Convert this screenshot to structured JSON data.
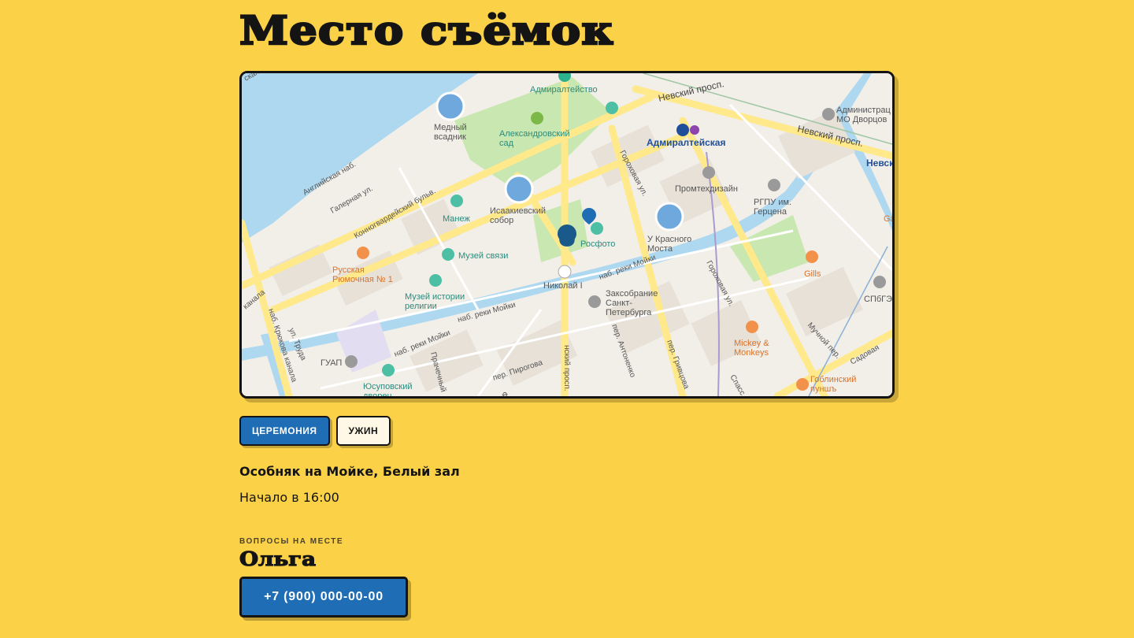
{
  "page": {
    "title": "Место съёмок"
  },
  "map": {
    "labels": {
      "admiralteystvo": "Адмиралтейство",
      "medny": "Медный\nвсадник",
      "alexsad": "Александровский\nсад",
      "nevsky1": "Невский просп.",
      "nevsky2": "Невский просп.",
      "nevsky_cut": "Невск",
      "admin": "Администрац\nМО Дворцов",
      "metro": "Адмиралтейская",
      "metro_line": "5",
      "gorokhovaya1": "Гороховая ул.",
      "promtech": "Промтехдизайн",
      "rgpu": "РГПУ им.\nГерцена",
      "angl": "Английская наб.",
      "galernaya": "Галерная ул.",
      "konnogv": "Конногвардейский бульв.",
      "manezh": "Манеж",
      "isaac": "Исаакиевский\nсобор",
      "rosfoto": "Росфото",
      "krasny": "У Красного\nМоста",
      "gills": "Gills",
      "ga_cut": "Ga",
      "spbgu_cut": "СПбГЭ",
      "ryumochnaya": "Русская\nРюмочная № 1",
      "muzsvyazi": "Музей связи",
      "moyka1": "наб. реки Мойки",
      "nikolai": "Николай I",
      "zaksob": "Заксобрание\nСанкт-\nПетербурга",
      "gorokhovaya2": "Гороховая ул.",
      "mickey": "Mickey &\nMonkeys",
      "muchnoy": "Мучной пер.",
      "sadovaya": "Садовая",
      "muzrel": "Музей истории\nрелигии",
      "moyka2": "наб. реки Мойки",
      "moyka3": "наб. реки Мойки",
      "kanala": "канала",
      "kryukova": "наб. Крюкова канала",
      "truda": "ул. Труда",
      "guap": "ГУАП",
      "yusup": "Юсуповский\nдворец",
      "prachechny": "Прачечный",
      "pirogova": "пер. Пирогова",
      "voznes": "нский просп.",
      "antonenko": "пер. Антоненко",
      "grivtsova": "пер. Гривцова",
      "spass": "Спасс",
      "goblin": "Гоблинский\nпуншъ",
      "ska": "ская",
      "fo": "Фо"
    }
  },
  "tabs": [
    {
      "label": "ЦЕРЕМОНИЯ",
      "active": true
    },
    {
      "label": "УЖИН",
      "active": false
    }
  ],
  "venue": "Особняк на Мойке, Белый зал",
  "start_time": "Начало в 16:00",
  "contact": {
    "caption": "ВОПРОСЫ НА МЕСТЕ",
    "name": "Ольга",
    "phone": "+7 (900) 000-00-00"
  },
  "colors": {
    "background": "#FBD147",
    "accent_blue": "#1F6DB5",
    "ink": "#141414",
    "map_water": "#ADD8F0",
    "map_park": "#C9E7B0",
    "map_road": "#FFE98A",
    "marker": "#1A5A8A"
  },
  "icons": [
    "museum-icon",
    "park-icon",
    "metro-icon",
    "restaurant-icon",
    "cafe-icon",
    "university-icon",
    "monument-icon",
    "location-pin-icon"
  ]
}
